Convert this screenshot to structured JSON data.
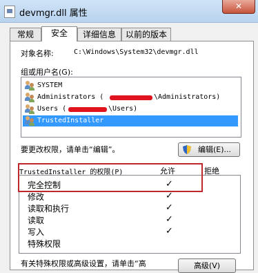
{
  "window": {
    "title": "devmgr.dll 属性",
    "close_label": "✕"
  },
  "tabs": [
    {
      "label": "常规",
      "active": false
    },
    {
      "label": "安全",
      "active": true
    },
    {
      "label": "详细信息",
      "active": false
    },
    {
      "label": "以前的版本",
      "active": false
    }
  ],
  "object": {
    "label": "对象名称:",
    "value": "C:\\Windows\\System32\\devmgr.dll"
  },
  "groups": {
    "label": "组或用户名(G):",
    "items": [
      {
        "text": "SYSTEM",
        "selected": false
      },
      {
        "text": "Administrators (",
        "suffix": "\\Administrators)",
        "selected": false
      },
      {
        "text": "Users (",
        "suffix": "\\Users)",
        "selected": false
      },
      {
        "text": "TrustedInstaller",
        "selected": true
      }
    ]
  },
  "edit": {
    "hint": "要更改权限，请单击“编辑”。",
    "button_label": "编辑(E)..."
  },
  "permissions": {
    "header_label": "TrustedInstaller 的权限(P)",
    "allow_label": "允许",
    "deny_label": "拒绝",
    "rows": [
      {
        "name": "完全控制",
        "allow": true
      },
      {
        "name": "修改",
        "allow": true
      },
      {
        "name": "读取和执行",
        "allow": true
      },
      {
        "name": "读取",
        "allow": true
      },
      {
        "name": "写入",
        "allow": true
      },
      {
        "name": "特殊权限",
        "allow": false
      }
    ],
    "check_glyph": "✓"
  },
  "advanced": {
    "hint": "有关特殊权限或高级设置，请单击“高",
    "button_label": "高级(V)"
  },
  "colors": {
    "selection": "#3399ff",
    "highlight_box": "#c0282d",
    "redaction": "#e0141e"
  }
}
